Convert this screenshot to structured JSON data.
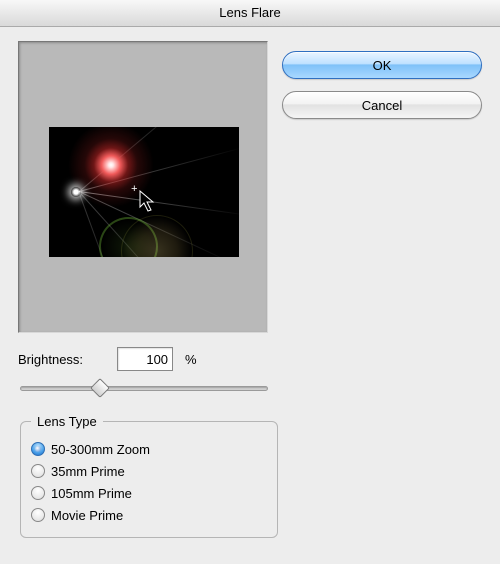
{
  "window": {
    "title": "Lens Flare"
  },
  "buttons": {
    "ok": "OK",
    "cancel": "Cancel"
  },
  "brightness": {
    "label": "Brightness:",
    "value": "100",
    "unit": "%",
    "slider_min": 10,
    "slider_max": 300,
    "slider_value": 100
  },
  "lens_type": {
    "legend": "Lens Type",
    "selected_index": 0,
    "options": [
      "50-300mm Zoom",
      "35mm Prime",
      "105mm Prime",
      "Movie Prime"
    ]
  }
}
